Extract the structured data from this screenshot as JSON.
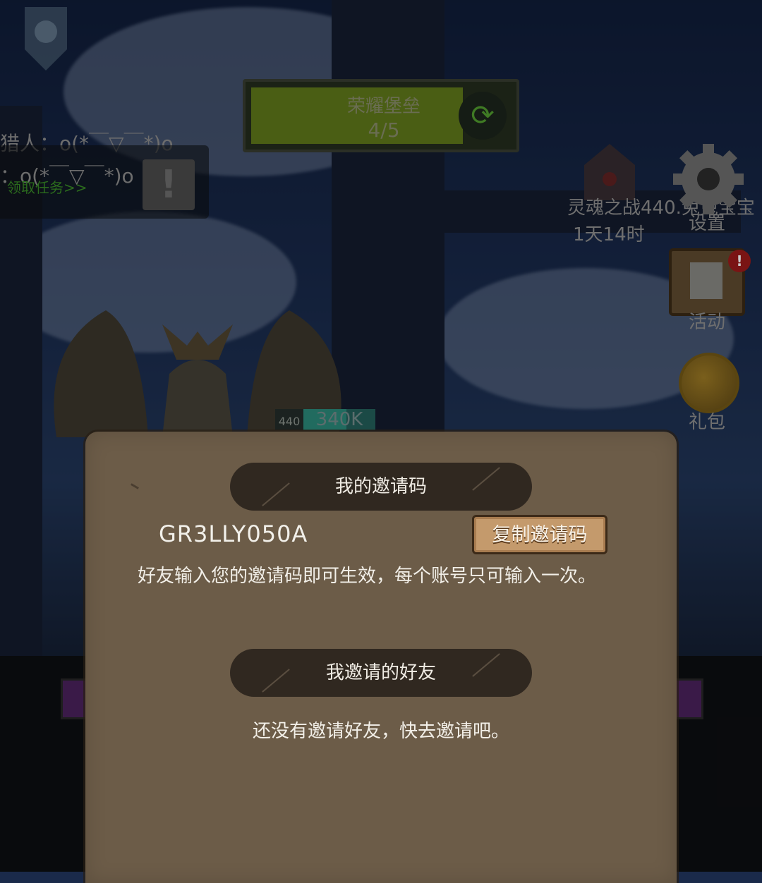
{
  "fortress": {
    "title": "荣耀堡垒",
    "progress": "4/5",
    "swap_icon": "swap-arrows-icon"
  },
  "quest": {
    "line1": "猎人：o(*￣▽￣*)o",
    "line2": "：o(*￣▽￣*)o",
    "link": "领取任务>>"
  },
  "side": {
    "soul_label": "灵魂之战",
    "soul_timer": "1天14时",
    "player_tag": "440.兔兔宝宝",
    "settings_label": "设置",
    "activity_label": "活动",
    "activity_badge": "!",
    "gift_label": "礼包"
  },
  "power": {
    "level": "440",
    "value": "340K",
    "fill": 0.6
  },
  "modal": {
    "my_code_header": "我的邀请码",
    "invite_code": "GR3LLY050A",
    "copy_button": "复制邀请码",
    "description": "好友输入您的邀请码即可生效，每个账号只可输入一次。",
    "friends_header": "我邀请的好友",
    "empty_text": "还没有邀请好友，快去邀请吧。"
  },
  "colors": {
    "modal_bg": "#6c5c48",
    "header_bg": "#302820",
    "button_bg": "#c49a6c"
  }
}
